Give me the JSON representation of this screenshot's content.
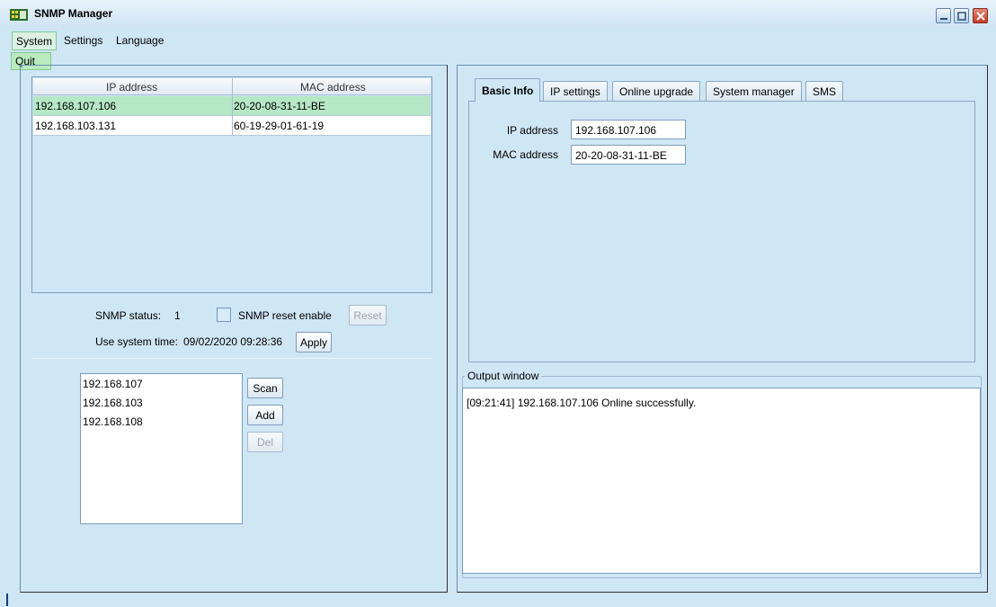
{
  "window": {
    "title": "SNMP Manager",
    "icon": "app-icon",
    "controls": [
      "minimize-icon",
      "maximize-icon",
      "close-icon"
    ]
  },
  "menubar": {
    "items": [
      "System",
      "Settings",
      "Language"
    ],
    "open_menu": {
      "parent": "System",
      "items": [
        "Quit"
      ]
    }
  },
  "device_table": {
    "columns": [
      "IP address",
      "MAC address"
    ],
    "rows": [
      {
        "ip": "192.168.107.106",
        "mac": "20-20-08-31-11-BE",
        "selected": true
      },
      {
        "ip": "192.168.103.131",
        "mac": "60-19-29-01-61-19",
        "selected": false
      }
    ]
  },
  "snmp": {
    "status_label": "SNMP status:",
    "status_value": "1",
    "reset_enable_label": "SNMP reset enable",
    "reset_enable_checked": false,
    "reset_button": "Reset",
    "system_time_label": "Use system time:",
    "system_time_value": "09/02/2020 09:28:36",
    "apply_button": "Apply"
  },
  "subnets": {
    "items": [
      "192.168.107",
      "192.168.103",
      "192.168.108"
    ],
    "scan_button": "Scan",
    "add_button": "Add",
    "del_button": "Del"
  },
  "tabs": {
    "items": [
      "Basic Info",
      "IP settings",
      "Online upgrade",
      "System manager",
      "SMS"
    ],
    "active": "Basic Info"
  },
  "basic_info": {
    "ip_label": "IP address",
    "ip_value": "192.168.107.106",
    "mac_label": "MAC address",
    "mac_value": "20-20-08-31-11-BE"
  },
  "output": {
    "title": "Output window",
    "lines": [
      "[09:21:41]  192.168.107.106 Online successfully."
    ]
  },
  "colors": {
    "background": "#cfe6f5",
    "selected_row": "#b6e7c6",
    "menu_highlight": "#b9ebbf"
  }
}
